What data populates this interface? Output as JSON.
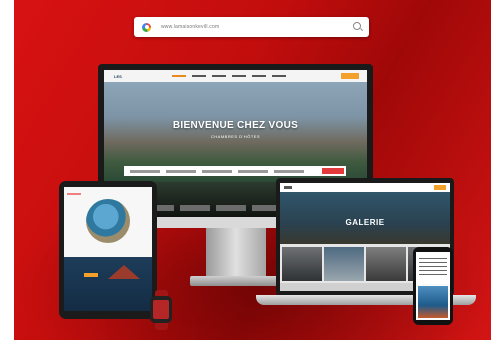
{
  "search_bar": {
    "url": "www.lamaisonkevill.com"
  },
  "desktop_site": {
    "logo_text": "LES",
    "hero_title": "BIENVENUE CHEZ VOUS",
    "hero_subtitle": "CHAMBRES D'HÔTES"
  },
  "laptop_site": {
    "page_title": "GALERIE"
  },
  "colors": {
    "brand_red": "#d31414",
    "accent_orange": "#f3a12a"
  },
  "icons": [
    "google-icon",
    "search-icon"
  ]
}
